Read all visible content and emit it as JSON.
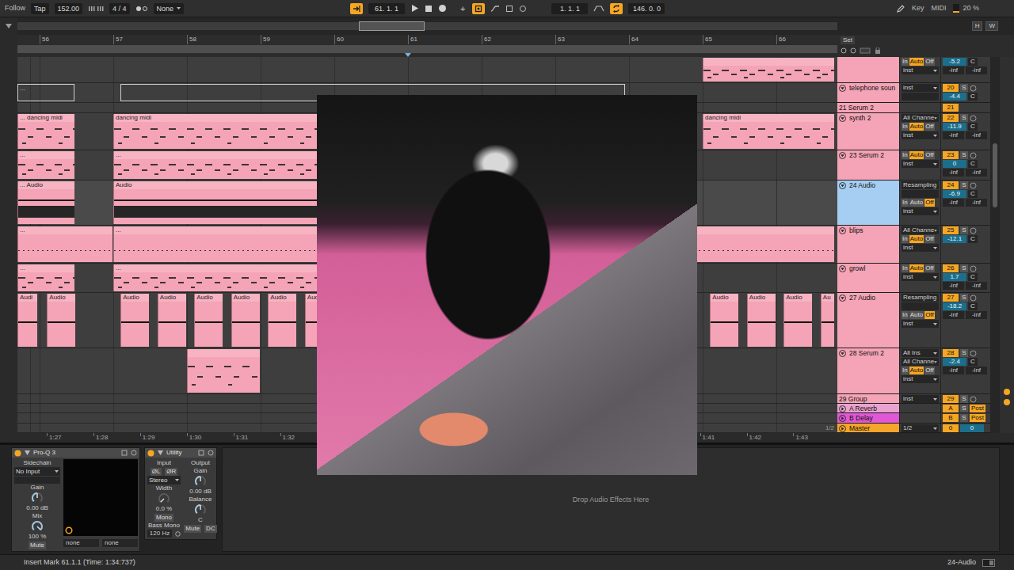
{
  "transport": {
    "follow": "Follow",
    "tap": "Tap",
    "tempo": "152.00",
    "signature": "4 / 4",
    "quantize": "None",
    "back_to_arrangement": true,
    "position": "61. 1. 1",
    "overdub": "+",
    "automation_arm": true,
    "loop_start": "1. 1. 1",
    "loop_enabled": true,
    "loop_length": "146. 0. 0",
    "key": "Key",
    "midi": "MIDI",
    "cpu": "20 %",
    "cpu_level": 0.2
  },
  "overview": {
    "viewport_start": 0.416,
    "level": 0.081,
    "buttons": [
      "H",
      "W"
    ]
  },
  "ruler": {
    "bars": [
      "56",
      "57",
      "58",
      "59",
      "60",
      "61",
      "62",
      "63",
      "64",
      "65",
      "66"
    ],
    "insert_mark_bar": 61,
    "set": "Set"
  },
  "time_ruler": [
    "1:27",
    "1:28",
    "1:29",
    "1:30",
    "1:31",
    "1:32",
    "1:41",
    "1:42",
    "1:43"
  ],
  "tracks": [
    {
      "color": "#f4a4b6",
      "selected": false,
      "io": [
        {
          "kind": "monitor",
          "options": [
            {
              "label": "In",
              "selected": false
            },
            {
              "label": "Auto",
              "selected": true
            },
            {
              "label": "Off",
              "selected": false
            }
          ]
        },
        {
          "kind": "select",
          "text": "inst"
        }
      ],
      "mixer": {
        "volume": "-5.2",
        "pan": "C",
        "meters": [
          "-inf",
          "-inf"
        ]
      },
      "clips": [
        {
          "kind": "midi",
          "bar": 65,
          "bars": 1.8
        }
      ]
    },
    {
      "name": "telephone soun",
      "color": "#f4a4b6",
      "selected": false,
      "expanded": true,
      "io": [
        {
          "kind": "select",
          "text": "inst"
        },
        {
          "kind": "field"
        }
      ],
      "mixer": {
        "number": "20",
        "solo": "S",
        "volume": "-4.4",
        "pan": "C"
      },
      "clips": [
        {
          "kind": "outline",
          "bar": 55.7,
          "bars": 0.78,
          "label": "..."
        },
        {
          "kind": "outline",
          "bar": 57.1,
          "bars": 6.86
        }
      ]
    },
    {
      "name": "21 Serum 2",
      "color": "#f4a4b6",
      "selected": false,
      "io": [],
      "mixer": {
        "number": "21"
      },
      "clips": []
    },
    {
      "name": "synth 2",
      "color": "#f4a4b6",
      "selected": false,
      "expanded": true,
      "io": [
        {
          "kind": "select",
          "text": "All Channe"
        },
        {
          "kind": "monitor",
          "options": [
            {
              "label": "In",
              "selected": false
            },
            {
              "label": "Auto",
              "selected": true
            },
            {
              "label": "Off",
              "selected": false
            }
          ]
        },
        {
          "kind": "select",
          "text": "inst"
        }
      ],
      "mixer": {
        "number": "22",
        "solo": "S",
        "volume": "-11.9",
        "pan": "C",
        "meters": [
          "-inf",
          "-inf"
        ]
      },
      "clips": [
        {
          "kind": "midi",
          "bar": 55.7,
          "bars": 0.78,
          "label": "... dancing midi"
        },
        {
          "kind": "midi",
          "bar": 57,
          "bars": 7.9,
          "label": "dancing midi"
        },
        {
          "kind": "midi",
          "bar": 65,
          "bars": 1.8,
          "label": "dancing midi"
        }
      ]
    },
    {
      "name": "23 Serum 2",
      "color": "#f4a4b6",
      "selected": false,
      "expanded": true,
      "io": [
        {
          "kind": "monitor",
          "options": [
            {
              "label": "In",
              "selected": false
            },
            {
              "label": "Auto",
              "selected": true
            },
            {
              "label": "Off",
              "selected": false
            }
          ]
        },
        {
          "kind": "select",
          "text": "inst"
        }
      ],
      "mixer": {
        "number": "23",
        "solo": "S",
        "volume": "0",
        "pan": "C",
        "meters": [
          "-inf",
          "-inf"
        ]
      },
      "clips": [
        {
          "kind": "midi",
          "bar": 55.7,
          "bars": 0.78,
          "label": "..."
        },
        {
          "kind": "midi",
          "bar": 57,
          "bars": 7.9,
          "label": "..."
        }
      ]
    },
    {
      "name": "24 Audio",
      "color": "#a6cdf2",
      "selected": true,
      "expanded": true,
      "io": [
        {
          "kind": "select",
          "text": "Resampling"
        },
        {
          "kind": "field"
        },
        {
          "kind": "monitor",
          "options": [
            {
              "label": "In",
              "selected": false
            },
            {
              "label": "Auto",
              "selected": false
            },
            {
              "label": "Off",
              "selected": true
            }
          ]
        },
        {
          "kind": "select",
          "text": "inst"
        }
      ],
      "mixer": {
        "number": "24",
        "solo": "S",
        "volume": "-6.9",
        "pan": "C",
        "meters": [
          "-inf",
          "-inf"
        ]
      },
      "clips": [
        {
          "kind": "audio",
          "bar": 55.7,
          "bars": 0.78,
          "label": "... Audio"
        },
        {
          "kind": "audio",
          "bar": 57,
          "bars": 7.9,
          "label": "Audio"
        }
      ]
    },
    {
      "name": "blips",
      "color": "#f4a4b6",
      "selected": false,
      "expanded": true,
      "io": [
        {
          "kind": "select",
          "text": "All Channe"
        },
        {
          "kind": "monitor",
          "options": [
            {
              "label": "In",
              "selected": false
            },
            {
              "label": "Auto",
              "selected": true
            },
            {
              "label": "Off",
              "selected": false
            }
          ]
        },
        {
          "kind": "select",
          "text": "inst"
        }
      ],
      "mixer": {
        "number": "25",
        "solo": "S",
        "volume": "-12.1",
        "pan": "C"
      },
      "clips": [
        {
          "kind": "dots",
          "bar": 55.7,
          "bars": 1.3,
          "label": "..."
        },
        {
          "kind": "dots",
          "bar": 57,
          "bars": 9.8,
          "label": "..."
        }
      ]
    },
    {
      "name": "growl",
      "color": "#f4a4b6",
      "selected": false,
      "expanded": true,
      "io": [
        {
          "kind": "monitor",
          "options": [
            {
              "label": "In",
              "selected": false
            },
            {
              "label": "Auto",
              "selected": true
            },
            {
              "label": "Off",
              "selected": false
            }
          ]
        },
        {
          "kind": "select",
          "text": "inst"
        }
      ],
      "mixer": {
        "number": "26",
        "solo": "S",
        "volume": "1.7",
        "pan": "C",
        "meters": [
          "-inf",
          "-inf"
        ]
      },
      "clips": [
        {
          "kind": "midi",
          "bar": 55.7,
          "bars": 0.78,
          "label": "..."
        },
        {
          "kind": "midi",
          "bar": 57,
          "bars": 7.9,
          "label": "..."
        }
      ]
    },
    {
      "name": "27 Audio",
      "color": "#f4a4b6",
      "selected": false,
      "expanded": true,
      "io": [
        {
          "kind": "select",
          "text": "Resampling"
        },
        {
          "kind": "field"
        },
        {
          "kind": "monitor",
          "options": [
            {
              "label": "In",
              "selected": false
            },
            {
              "label": "Auto",
              "selected": false
            },
            {
              "label": "Off",
              "selected": true
            }
          ]
        },
        {
          "kind": "select",
          "text": "inst"
        }
      ],
      "mixer": {
        "number": "27",
        "solo": "S",
        "volume": "-18.2",
        "pan": "C",
        "meters": [
          "-inf",
          "-inf"
        ]
      },
      "clips": [
        {
          "kind": "hit",
          "bar": 55.7,
          "bars": 0.28,
          "label": "Audi"
        },
        {
          "kind": "hit",
          "bar": 56.1,
          "bars": 0.4,
          "label": "Audio"
        },
        {
          "kind": "hit",
          "bar": 57.1,
          "bars": 0.4,
          "label": "Audio"
        },
        {
          "kind": "hit",
          "bar": 57.6,
          "bars": 0.4,
          "label": "Audio"
        },
        {
          "kind": "hit",
          "bar": 58.1,
          "bars": 0.4,
          "label": "Audio"
        },
        {
          "kind": "hit",
          "bar": 58.6,
          "bars": 0.4,
          "label": "Audio"
        },
        {
          "kind": "hit",
          "bar": 59.1,
          "bars": 0.4,
          "label": "Audio"
        },
        {
          "kind": "hit",
          "bar": 59.6,
          "bars": 0.4,
          "label": "Audio"
        },
        {
          "kind": "hit",
          "bar": 65.1,
          "bars": 0.4,
          "label": "Audio"
        },
        {
          "kind": "hit",
          "bar": 65.6,
          "bars": 0.4,
          "label": "Audio"
        },
        {
          "kind": "hit",
          "bar": 66.1,
          "bars": 0.4,
          "label": "Audio"
        },
        {
          "kind": "hit",
          "bar": 66.6,
          "bars": 0.2,
          "label": "Au"
        }
      ]
    },
    {
      "name": "28 Serum 2",
      "color": "#f4a4b6",
      "selected": false,
      "expanded": true,
      "io": [
        {
          "kind": "select",
          "text": "All Ins"
        },
        {
          "kind": "select",
          "text": "All Channe"
        },
        {
          "kind": "monitor",
          "options": [
            {
              "label": "In",
              "selected": false
            },
            {
              "label": "Auto",
              "selected": true
            },
            {
              "label": "Off",
              "selected": false
            }
          ]
        },
        {
          "kind": "select",
          "text": "inst"
        }
      ],
      "mixer": {
        "number": "28",
        "solo": "S",
        "volume": "-2.4",
        "pan": "C",
        "meters": [
          "-inf",
          "-inf"
        ]
      },
      "clips": [
        {
          "kind": "midi",
          "bar": 58,
          "bars": 1
        }
      ]
    },
    {
      "name": "29 Group",
      "color": "#f4a4b6",
      "selected": false,
      "io": [
        {
          "kind": "select",
          "text": "inst"
        }
      ],
      "mixer": {
        "number": "29",
        "solo": "S"
      },
      "clips": []
    },
    {
      "name": "A Reverb",
      "color": "#e9a3cf",
      "selected": false,
      "expanded": false,
      "io": [],
      "mixer": {
        "number": "A",
        "solo": "S",
        "post": "Post"
      },
      "clips": []
    },
    {
      "name": "B Delay",
      "color": "#e157d6",
      "selected": false,
      "expanded": false,
      "io": [],
      "mixer": {
        "number": "B",
        "solo": "S",
        "post": "Post"
      },
      "clips": []
    },
    {
      "name": "Master",
      "color": "#f4a52a",
      "selected": false,
      "expanded": false,
      "io": [
        {
          "kind": "select",
          "text": "1/2"
        }
      ],
      "mixer": {
        "number": "0",
        "volume": "0"
      },
      "clips": [],
      "lane_label": "1/2"
    }
  ],
  "scrollbar": {
    "start": 0.23,
    "level": 0.17
  },
  "devices": [
    {
      "kind": "eq",
      "title": "Pro-Q 3",
      "on": true,
      "sidechain_label": "Sidechain",
      "sidechain": "No Input",
      "gain_label": "Gain",
      "gain": "0.00 dB",
      "gain_level": 0.5,
      "mix_label": "Mix",
      "mix": "100 %",
      "mix_level": 1,
      "mute": "Mute",
      "outputs": [
        "none",
        "none"
      ]
    },
    {
      "kind": "utility",
      "title": "Utility",
      "on": true,
      "input_label": "Input",
      "phase": [
        "ØL",
        "ØR"
      ],
      "channel_mode": "Stereo",
      "width_label": "Width",
      "width": "0.0 %",
      "width_level": 0,
      "mono": "Mono",
      "bass_mono": "Bass Mono",
      "bass_freq": "120 Hz",
      "output_label": "Output",
      "gain_label": "Gain",
      "gain": "0.00 dB",
      "gain_level": 0.5,
      "balance_label": "Balance",
      "balance": "C",
      "balance_level": 0.5,
      "mute": "Mute",
      "dc": "DC"
    }
  ],
  "drop_hint": "Drop Audio Effects Here",
  "status_bar": {
    "message": "Insert Mark 61.1.1 (Time: 1:34:737)",
    "selection": "24-Audio"
  }
}
